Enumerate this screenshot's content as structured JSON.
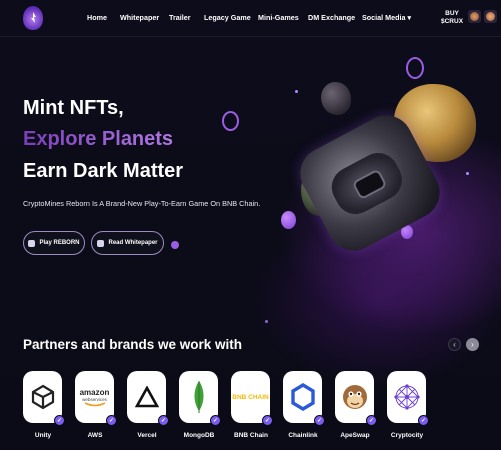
{
  "nav": {
    "items": [
      "Home",
      "Whitepaper",
      "Trailer",
      "Legacy Game",
      "Mini-Games",
      "DM Exchange",
      "Social Media"
    ],
    "social_caret": "▾",
    "buy_line1": "BUY",
    "buy_line2": "$CRUX"
  },
  "hero": {
    "line1": "Mint NFTs,",
    "line2": "Explore Planets",
    "line3": "Earn Dark Matter",
    "subtitle": "CryptoMines Reborn Is A Brand-New Play-To-Earn Game On BNB Chain.",
    "play_button": "Play REBORN",
    "whitepaper_button": "Read Whitepaper"
  },
  "partners": {
    "title": "Partners and brands we work with",
    "prev_arrow": "‹",
    "next_arrow": "›",
    "items": [
      {
        "name": "Unity",
        "icon": "unity-logo-icon"
      },
      {
        "name": "AWS",
        "icon": "aws-logo-icon",
        "logo_text": "amazon",
        "logo_sub": "webservices"
      },
      {
        "name": "Vercel",
        "icon": "vercel-logo-icon"
      },
      {
        "name": "MongoDB",
        "icon": "mongodb-logo-icon"
      },
      {
        "name": "BNB Chain",
        "icon": "bnb-chain-logo-icon",
        "logo_text": "BNB CHAIN"
      },
      {
        "name": "Chainlink",
        "icon": "chainlink-logo-icon"
      },
      {
        "name": "ApeSwap",
        "icon": "apeswap-logo-icon"
      },
      {
        "name": "Cryptocity",
        "icon": "cryptocity-logo-icon"
      }
    ]
  },
  "colors": {
    "accent": "#9b5de5",
    "check": "#7a5cf0",
    "background": "#0b0b16"
  }
}
